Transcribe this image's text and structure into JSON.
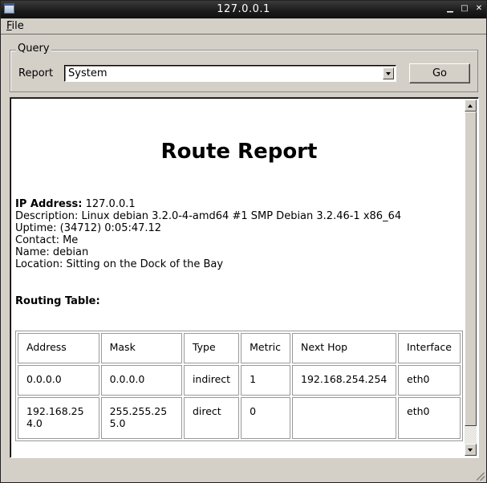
{
  "window": {
    "title": "127.0.0.1",
    "controls": {
      "minimize": "▁",
      "maximize": "□",
      "close": "✕"
    }
  },
  "menubar": {
    "items": [
      {
        "label_mnemonic": "F",
        "label_rest": "ile"
      }
    ]
  },
  "query": {
    "group_label": "Query",
    "report_label": "Report",
    "report_value": "System",
    "go_label": "Go"
  },
  "report": {
    "title": "Route Report",
    "ip_label": "IP Address:",
    "ip_value": " 127.0.0.1",
    "lines": [
      "Description: Linux debian 3.2.0-4-amd64 #1 SMP Debian 3.2.46-1 x86_64",
      "Uptime: (34712) 0:05:47.12",
      "Contact: Me",
      "Name: debian",
      "Location: Sitting on the Dock of the Bay"
    ],
    "routing_label": "Routing Table:",
    "table": {
      "headers": [
        "Address",
        "Mask",
        "Type",
        "Metric",
        "Next Hop",
        "Interface"
      ],
      "rows": [
        [
          "0.0.0.0",
          "0.0.0.0",
          "indirect",
          "1",
          "192.168.254.254",
          "eth0"
        ],
        [
          "192.168.254.0",
          "255.255.255.0",
          "direct",
          "0",
          "",
          "eth0"
        ]
      ]
    }
  }
}
